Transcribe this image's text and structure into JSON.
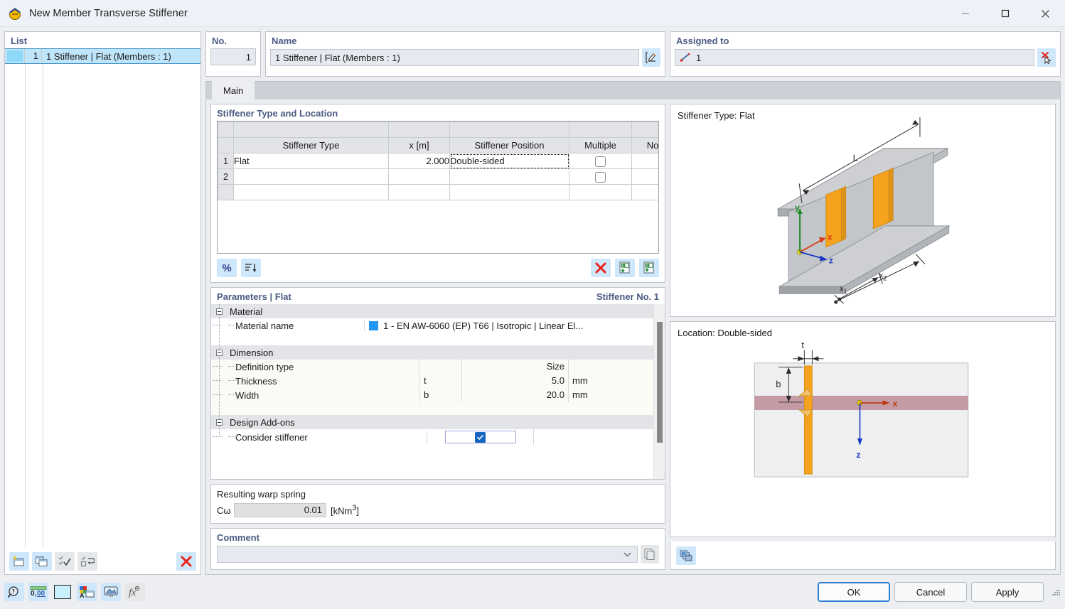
{
  "window": {
    "title": "New Member Transverse Stiffener",
    "app_icon": "stiffener-app-icon",
    "minimize_label": "—",
    "maximize_label": "□",
    "close_label": "✕"
  },
  "list": {
    "title": "List",
    "rows": [
      {
        "swatch_color": "#8ed8f8",
        "no": "1",
        "name": "1 Stiffener | Flat (Members : 1)"
      }
    ],
    "toolbar": [
      {
        "name": "new-item-button",
        "title": "New"
      },
      {
        "name": "copy-item-button",
        "title": "Copy"
      },
      {
        "name": "select-all-button",
        "title": "Select All"
      },
      {
        "name": "invert-selection-button",
        "title": "Invert Selection"
      },
      {
        "name": "delete-item-button",
        "title": "Delete"
      }
    ]
  },
  "no_field": {
    "label": "No.",
    "value": "1"
  },
  "name_field": {
    "label": "Name",
    "value": "1 Stiffener | Flat (Members : 1)",
    "edit_button": "edit-name-button"
  },
  "assigned_to": {
    "label": "Assigned to",
    "value": "1",
    "member_icon": "member-icon",
    "pick_button": "deselect-button"
  },
  "tabs": [
    {
      "label": "Main",
      "active": true
    }
  ],
  "stiffener_table": {
    "title": "Stiffener Type and Location",
    "columns": [
      "Stiffener Type",
      "x [m]",
      "Stiffener Position",
      "Multiple",
      "Note"
    ],
    "rows": [
      {
        "no": "1",
        "type": "Flat",
        "x": "2.000",
        "position": "Double-sided",
        "multiple": false,
        "note": ""
      },
      {
        "no": "2",
        "type": "",
        "x": "",
        "position": "",
        "multiple": false,
        "note": ""
      }
    ],
    "toolbar_left": [
      {
        "name": "percent-button",
        "label": "%"
      },
      {
        "name": "sort-button",
        "label": "sort-descending-icon"
      }
    ],
    "toolbar_right": [
      {
        "name": "delete-rows-button",
        "label": "delete-x-icon"
      },
      {
        "name": "import-excel-button",
        "label": "excel-import-icon"
      },
      {
        "name": "export-excel-button",
        "label": "excel-export-icon"
      }
    ]
  },
  "parameters": {
    "title": "Parameters | Flat",
    "stiffener_no": "Stiffener No. 1",
    "sections": [
      {
        "name": "Material",
        "rows": [
          {
            "label": "Material name",
            "kind": "material",
            "swatch": "#2196f3",
            "value": "1 - EN AW-6060 (EP) T66 | Isotropic | Linear El..."
          }
        ]
      },
      {
        "name": "Dimension",
        "rows": [
          {
            "label": "Definition type",
            "symbol": "",
            "value": "Size",
            "unit": ""
          },
          {
            "label": "Thickness",
            "symbol": "t",
            "value": "5.0",
            "unit": "mm"
          },
          {
            "label": "Width",
            "symbol": "b",
            "value": "20.0",
            "unit": "mm"
          }
        ]
      },
      {
        "name": "Design Add-ons",
        "rows": [
          {
            "label": "Consider stiffener",
            "kind": "checkbox",
            "checked": true
          }
        ]
      }
    ]
  },
  "warp_spring": {
    "title": "Resulting warp spring",
    "symbol": "Cω",
    "value": "0.01",
    "unit_prefix": "[kNm",
    "unit_sup": "3",
    "unit_suffix": "]"
  },
  "comment": {
    "title": "Comment",
    "value": "",
    "dropdown_icon": "chevron-down-icon",
    "copy_button": "comment-templates-button"
  },
  "graphics": {
    "top": {
      "title": "Stiffener Type: Flat",
      "labels": {
        "L": "L",
        "x1": "x",
        "x1_sub": "1",
        "x2": "x",
        "x2_sub": "2",
        "axis_x": "x",
        "axis_y": "y",
        "axis_z": "z"
      }
    },
    "bottom": {
      "title": "Location: Double-sided",
      "labels": {
        "t": "t",
        "b": "b",
        "axis_x": "x",
        "axis_z": "z"
      }
    },
    "footer_button": "render-mode-button"
  },
  "status_toolbar": [
    {
      "name": "help-button",
      "icon": "help-magnifier-icon"
    },
    {
      "name": "units-button",
      "icon": "units-000-icon"
    },
    {
      "name": "color-button",
      "icon": "color-swatch-icon"
    },
    {
      "name": "display-properties-button",
      "icon": "display-props-icon"
    },
    {
      "name": "view-button",
      "icon": "view-screen-icon"
    },
    {
      "name": "formula-button",
      "icon": "formula-fx-icon"
    }
  ],
  "dialog_buttons": {
    "ok": "OK",
    "cancel": "Cancel",
    "apply": "Apply"
  },
  "colors": {
    "accent": "#2f7fd1",
    "group_title": "#4a5b82",
    "selection": "#bfe5fa",
    "stiffener_orange": "#f5a21e",
    "web_pink": "#c49aa4"
  }
}
